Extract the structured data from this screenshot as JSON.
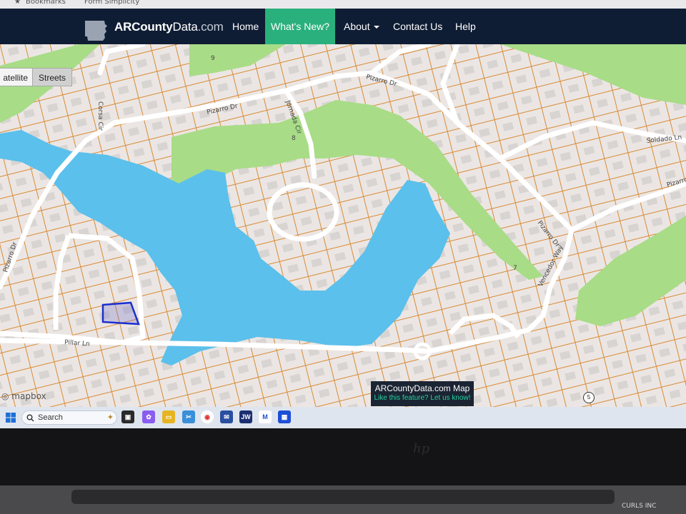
{
  "browser": {
    "bookmarks": [
      "Bookmarks",
      "Form Simplicity"
    ]
  },
  "site": {
    "logo_name_bold": "ARCounty",
    "logo_name_rest": "Data",
    "logo_domain": ".com",
    "nav": [
      {
        "label": "Home"
      },
      {
        "label": "What's New?"
      },
      {
        "label": "About"
      },
      {
        "label": "Contact Us"
      },
      {
        "label": "Help"
      }
    ],
    "active_nav": "What's New?",
    "accent_color": "#2ab07c",
    "navbar_color": "#0f1d34"
  },
  "map": {
    "toggle": {
      "satellite": "atellite",
      "streets": "Streets",
      "selected": "Streets"
    },
    "streets": [
      "Pizarro Dr",
      "Pizarro Dr",
      "Pizarro Dr",
      "Jornada Cir",
      "Soldado Ln",
      "Pizarro Dr",
      "Vencedor Way",
      "Pillar Ln",
      "Corsa Cir",
      "Pizarro Dr"
    ],
    "golf_hole_numbers": [
      "9",
      "8",
      "7"
    ],
    "attribution": "mapbox",
    "title": "ARCountyData.com Map",
    "feedback_link": "Like this feature? Let us know!",
    "route_badge": "5",
    "colors": {
      "water": "#5bc0eb",
      "green": "#a8dc87",
      "parcel_lines": "#d98a35",
      "roads": "#ffffff",
      "selected_parcel": "#1b2fd0"
    }
  },
  "taskbar": {
    "search_placeholder": "Search",
    "apps": [
      "windows-start",
      "file-explorer",
      "copilot",
      "folder",
      "snipping-tool",
      "chrome",
      "mail",
      "jw",
      "malwarebytes",
      "calculator"
    ],
    "jw_label": "JW"
  },
  "device": {
    "brand": "hp",
    "watermark": "CURLS INC"
  }
}
